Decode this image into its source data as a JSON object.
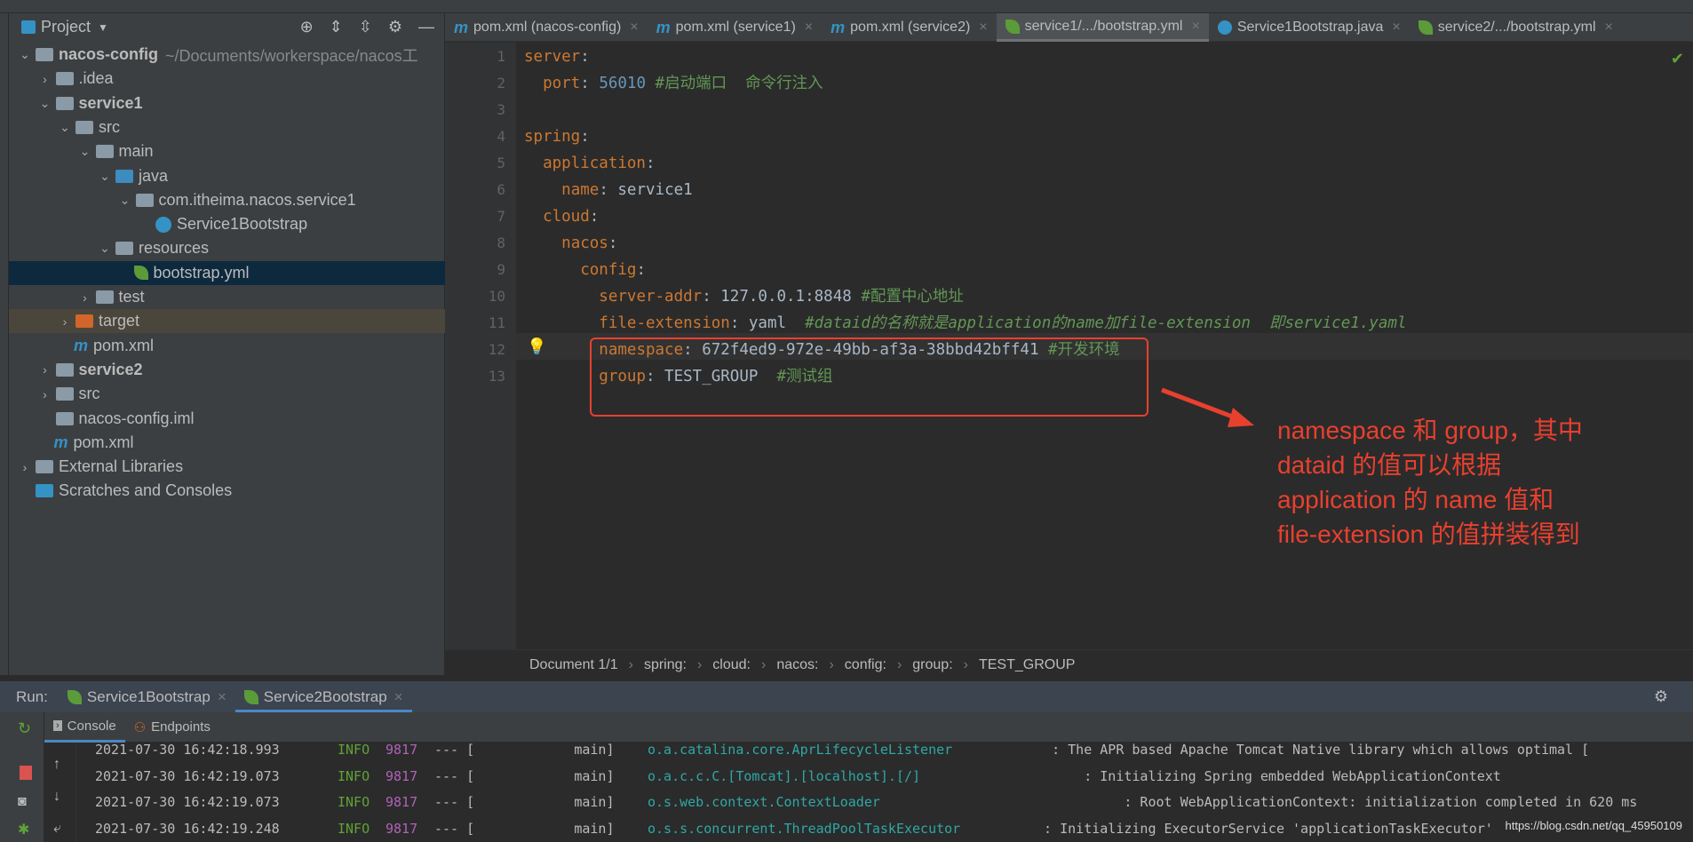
{
  "project_panel": {
    "title": "Project",
    "tree": [
      {
        "label": "nacos-config",
        "extra": "~/Documents/workerspace/nacos工",
        "level": 0,
        "chev": "v",
        "icon": "module",
        "bold": true
      },
      {
        "label": ".idea",
        "level": 1,
        "chev": ">",
        "icon": "folder"
      },
      {
        "label": "service1",
        "level": 1,
        "chev": "v",
        "icon": "module",
        "bold": true
      },
      {
        "label": "src",
        "level": 2,
        "chev": "v",
        "icon": "folder"
      },
      {
        "label": "main",
        "level": 3,
        "chev": "v",
        "icon": "folder"
      },
      {
        "label": "java",
        "level": 4,
        "chev": "v",
        "icon": "src-folder"
      },
      {
        "label": "com.itheima.nacos.service1",
        "level": 5,
        "chev": "v",
        "icon": "package"
      },
      {
        "label": "Service1Bootstrap",
        "level": 6,
        "chev": "",
        "icon": "spring-boot-class"
      },
      {
        "label": "resources",
        "level": 4,
        "chev": "v",
        "icon": "resources-folder"
      },
      {
        "label": "bootstrap.yml",
        "level": 5,
        "chev": "",
        "icon": "spring-yml",
        "selected": true
      },
      {
        "label": "test",
        "level": 3,
        "chev": ">",
        "icon": "folder"
      },
      {
        "label": "target",
        "level": 2,
        "chev": ">",
        "icon": "excluded-folder",
        "target": true
      },
      {
        "label": "pom.xml",
        "level": 2,
        "chev": "",
        "icon": "maven"
      },
      {
        "label": "service2",
        "level": 1,
        "chev": ">",
        "icon": "module",
        "bold": true
      },
      {
        "label": "src",
        "level": 1,
        "chev": ">",
        "icon": "folder"
      },
      {
        "label": "nacos-config.iml",
        "level": 1,
        "chev": "",
        "icon": "iml-file"
      },
      {
        "label": "pom.xml",
        "level": 1,
        "chev": "",
        "icon": "maven"
      },
      {
        "label": "External Libraries",
        "level": 0,
        "chev": ">",
        "icon": "libraries"
      },
      {
        "label": "Scratches and Consoles",
        "level": 0,
        "chev": "",
        "icon": "scratches"
      }
    ]
  },
  "tabs": [
    {
      "label": "pom.xml (nacos-config)",
      "icon": "maven"
    },
    {
      "label": "pom.xml (service1)",
      "icon": "maven"
    },
    {
      "label": "pom.xml (service2)",
      "icon": "maven"
    },
    {
      "label": "service1/.../bootstrap.yml",
      "icon": "spring-yml",
      "active": true
    },
    {
      "label": "Service1Bootstrap.java",
      "icon": "spring-boot-class"
    },
    {
      "label": "service2/.../bootstrap.yml",
      "icon": "spring-yml"
    }
  ],
  "editor": {
    "lines": [
      [
        [
          "k",
          "server"
        ],
        [
          "p",
          ":"
        ]
      ],
      [
        [
          "p",
          "  "
        ],
        [
          "k",
          "port"
        ],
        [
          "p",
          ": "
        ],
        [
          "n",
          "56010"
        ],
        [
          "c",
          " #启动端口  命令行注入"
        ]
      ],
      [],
      [
        [
          "k",
          "spring"
        ],
        [
          "p",
          ":"
        ]
      ],
      [
        [
          "p",
          "  "
        ],
        [
          "k",
          "application"
        ],
        [
          "p",
          ":"
        ]
      ],
      [
        [
          "p",
          "    "
        ],
        [
          "k",
          "name"
        ],
        [
          "p",
          ": service1"
        ]
      ],
      [
        [
          "p",
          "  "
        ],
        [
          "k",
          "cloud"
        ],
        [
          "p",
          ":"
        ]
      ],
      [
        [
          "p",
          "    "
        ],
        [
          "k",
          "nacos"
        ],
        [
          "p",
          ":"
        ]
      ],
      [
        [
          "p",
          "      "
        ],
        [
          "k",
          "config"
        ],
        [
          "p",
          ":"
        ]
      ],
      [
        [
          "p",
          "        "
        ],
        [
          "k",
          "server-addr"
        ],
        [
          "p",
          ": 127.0.0.1:8848 "
        ],
        [
          "c",
          "#配置中心地址"
        ]
      ],
      [
        [
          "p",
          "        "
        ],
        [
          "k",
          "file-extension"
        ],
        [
          "p",
          ": yaml  "
        ],
        [
          "ci",
          "#dataid的名称就是application的name加file-extension  即service1.yaml"
        ]
      ],
      [
        [
          "p",
          "        "
        ],
        [
          "k",
          "namespace"
        ],
        [
          "p",
          ": 672f4ed9-972e-49bb-af3a-38bbd42bff41 "
        ],
        [
          "c",
          "#开发环境"
        ]
      ],
      [
        [
          "p",
          "        "
        ],
        [
          "k",
          "group"
        ],
        [
          "p",
          ": TEST_GROUP  "
        ],
        [
          "c",
          "#测试组"
        ]
      ]
    ]
  },
  "breadcrumb": [
    "Document 1/1",
    "spring:",
    "cloud:",
    "nacos:",
    "config:",
    "group:",
    "TEST_GROUP"
  ],
  "annotation": [
    "namespace 和 group，其中",
    "dataid 的值可以根据",
    "application 的 name 值和",
    "file-extension 的值拼装得到"
  ],
  "run": {
    "label": "Run:",
    "tabs": [
      {
        "label": "Service1Bootstrap"
      },
      {
        "label": "Service2Bootstrap",
        "active": true
      }
    ],
    "console_tab": "Console",
    "endpoints_tab": "Endpoints",
    "logs": [
      {
        "time": "2021-07-30 16:42:18.993",
        "level": "INFO",
        "pid": "9817",
        "sep": "--- [",
        "thread": "           main]",
        "logger": "o.a.catalina.core.AprLifecycleListener",
        "msg": "   : The APR based Apache Tomcat Native library which allows optimal ["
      },
      {
        "time": "2021-07-30 16:42:19.073",
        "level": "INFO",
        "pid": "9817",
        "sep": "--- [",
        "thread": "           main]",
        "logger": "o.a.c.c.C.[Tomcat].[localhost].[/]",
        "msg": "       : Initializing Spring embedded WebApplicationContext"
      },
      {
        "time": "2021-07-30 16:42:19.073",
        "level": "INFO",
        "pid": "9817",
        "sep": "--- [",
        "thread": "           main]",
        "logger": "o.s.web.context.ContextLoader",
        "msg": "            : Root WebApplicationContext: initialization completed in 620 ms"
      },
      {
        "time": "2021-07-30 16:42:19.248",
        "level": "INFO",
        "pid": "9817",
        "sep": "--- [",
        "thread": "           main]",
        "logger": "o.s.s.concurrent.ThreadPoolTaskExecutor",
        "msg": "  : Initializing ExecutorService 'applicationTaskExecutor'"
      }
    ]
  },
  "watermark": "https://blog.csdn.net/qq_45950109",
  "colors": {
    "annotation": "#e8402f",
    "key": "#cc7832",
    "comment": "#629755",
    "selection": "#0d293e"
  }
}
